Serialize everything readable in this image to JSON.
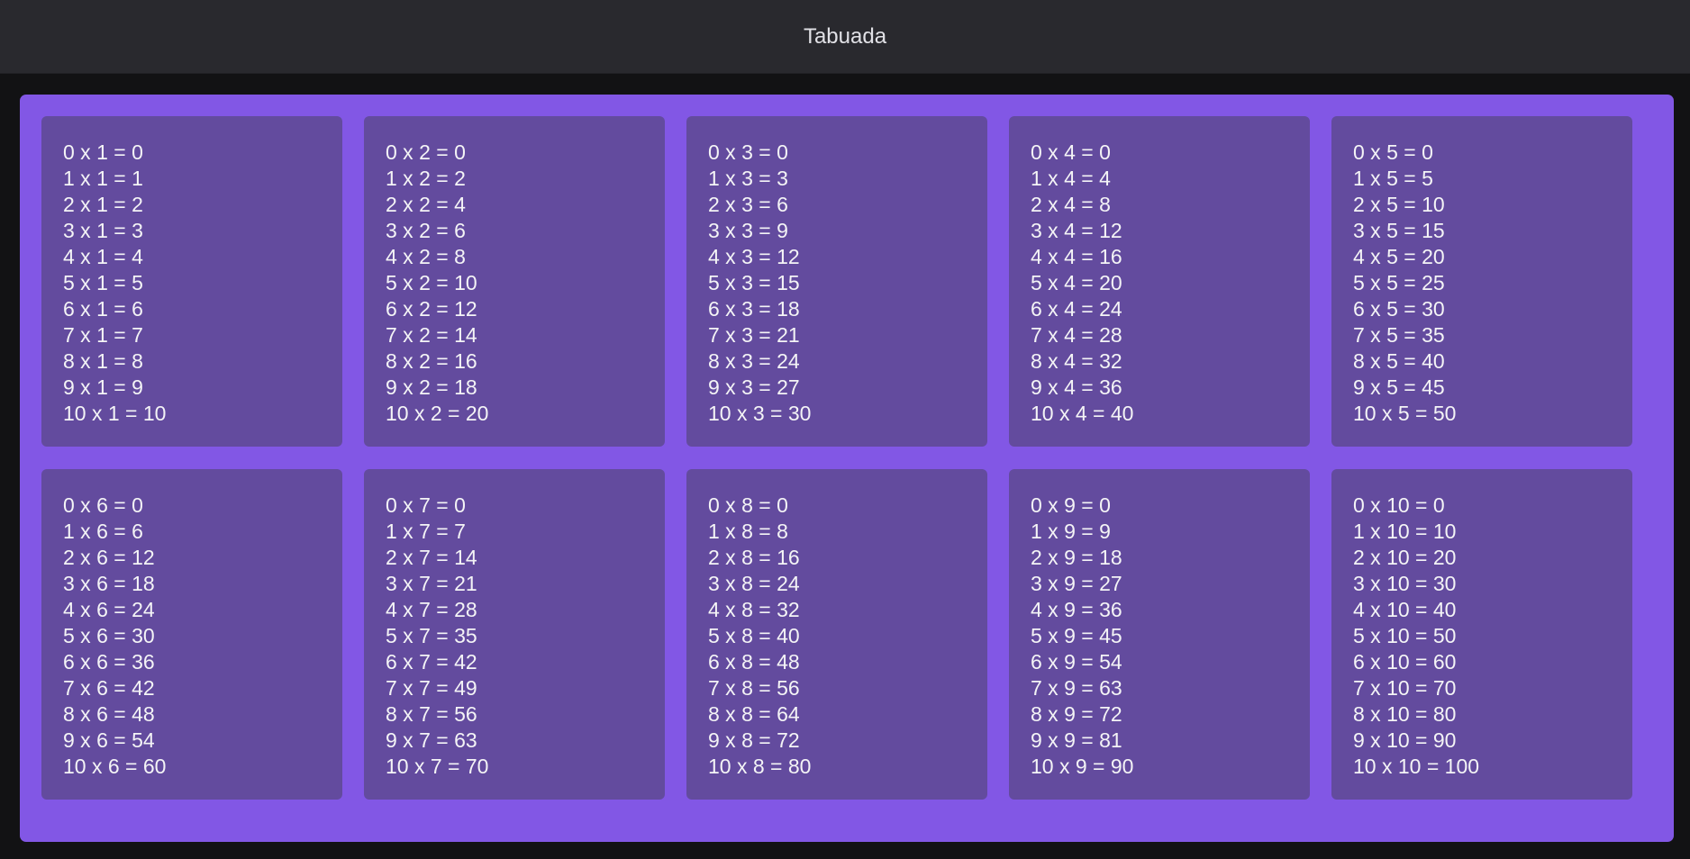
{
  "header": {
    "title": "Tabuada"
  },
  "tables": [
    {
      "lines": [
        "0 x 1 = 0",
        "1 x 1 = 1",
        "2 x 1 = 2",
        "3 x 1 = 3",
        "4 x 1 = 4",
        "5 x 1 = 5",
        "6 x 1 = 6",
        "7 x 1 = 7",
        "8 x 1 = 8",
        "9 x 1 = 9",
        "10 x 1 = 10"
      ]
    },
    {
      "lines": [
        "0 x 2 = 0",
        "1 x 2 = 2",
        "2 x 2 = 4",
        "3 x 2 = 6",
        "4 x 2 = 8",
        "5 x 2 = 10",
        "6 x 2 = 12",
        "7 x 2 = 14",
        "8 x 2 = 16",
        "9 x 2 = 18",
        "10 x 2 = 20"
      ]
    },
    {
      "lines": [
        "0 x 3 = 0",
        "1 x 3 = 3",
        "2 x 3 = 6",
        "3 x 3 = 9",
        "4 x 3 = 12",
        "5 x 3 = 15",
        "6 x 3 = 18",
        "7 x 3 = 21",
        "8 x 3 = 24",
        "9 x 3 = 27",
        "10 x 3 = 30"
      ]
    },
    {
      "lines": [
        "0 x 4 = 0",
        "1 x 4 = 4",
        "2 x 4 = 8",
        "3 x 4 = 12",
        "4 x 4 = 16",
        "5 x 4 = 20",
        "6 x 4 = 24",
        "7 x 4 = 28",
        "8 x 4 = 32",
        "9 x 4 = 36",
        "10 x 4 = 40"
      ]
    },
    {
      "lines": [
        "0 x 5 = 0",
        "1 x 5 = 5",
        "2 x 5 = 10",
        "3 x 5 = 15",
        "4 x 5 = 20",
        "5 x 5 = 25",
        "6 x 5 = 30",
        "7 x 5 = 35",
        "8 x 5 = 40",
        "9 x 5 = 45",
        "10 x 5 = 50"
      ]
    },
    {
      "lines": [
        "0 x 6 = 0",
        "1 x 6 = 6",
        "2 x 6 = 12",
        "3 x 6 = 18",
        "4 x 6 = 24",
        "5 x 6 = 30",
        "6 x 6 = 36",
        "7 x 6 = 42",
        "8 x 6 = 48",
        "9 x 6 = 54",
        "10 x 6 = 60"
      ]
    },
    {
      "lines": [
        "0 x 7 = 0",
        "1 x 7 = 7",
        "2 x 7 = 14",
        "3 x 7 = 21",
        "4 x 7 = 28",
        "5 x 7 = 35",
        "6 x 7 = 42",
        "7 x 7 = 49",
        "8 x 7 = 56",
        "9 x 7 = 63",
        "10 x 7 = 70"
      ]
    },
    {
      "lines": [
        "0 x 8 = 0",
        "1 x 8 = 8",
        "2 x 8 = 16",
        "3 x 8 = 24",
        "4 x 8 = 32",
        "5 x 8 = 40",
        "6 x 8 = 48",
        "7 x 8 = 56",
        "8 x 8 = 64",
        "9 x 8 = 72",
        "10 x 8 = 80"
      ]
    },
    {
      "lines": [
        "0 x 9 = 0",
        "1 x 9 = 9",
        "2 x 9 = 18",
        "3 x 9 = 27",
        "4 x 9 = 36",
        "5 x 9 = 45",
        "6 x 9 = 54",
        "7 x 9 = 63",
        "8 x 9 = 72",
        "9 x 9 = 81",
        "10 x 9 = 90"
      ]
    },
    {
      "lines": [
        "0 x 10 = 0",
        "1 x 10 = 10",
        "2 x 10 = 20",
        "3 x 10 = 30",
        "4 x 10 = 40",
        "5 x 10 = 50",
        "6 x 10 = 60",
        "7 x 10 = 70",
        "8 x 10 = 80",
        "9 x 10 = 90",
        "10 x 10 = 100"
      ]
    }
  ],
  "colors": {
    "page_background": "#121214",
    "header_background": "#29292e",
    "header_text": "#e1e1e6",
    "panel_background": "#8257e5",
    "card_background": "#634b9e",
    "card_text": "#f4f4f6"
  }
}
